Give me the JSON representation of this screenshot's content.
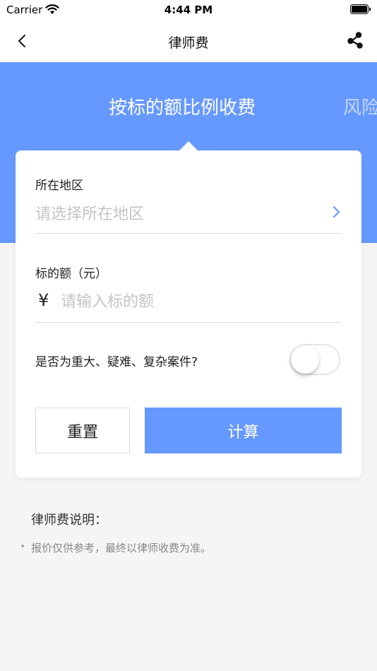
{
  "status_bar": {
    "carrier": "Carrier",
    "time": "4:44 PM"
  },
  "nav": {
    "title": "律师费",
    "back_icon": "chevron-left-icon",
    "share_icon": "share-icon"
  },
  "tabs": [
    {
      "label": "按标的额比例收费",
      "active": true
    },
    {
      "label": "风险",
      "active": false
    }
  ],
  "form": {
    "region": {
      "label": "所在地区",
      "placeholder": "请选择所在地区",
      "value": ""
    },
    "amount": {
      "label": "标的额（元）",
      "currency_symbol": "¥",
      "placeholder": "请输入标的额",
      "value": ""
    },
    "complex_case": {
      "label": "是否为重大、疑难、复杂案件?",
      "on": false
    },
    "reset_label": "重置",
    "calculate_label": "计算"
  },
  "notes": {
    "title": "律师费说明：",
    "items": [
      "报价仅供参考，最终以律师收费为准。"
    ]
  },
  "colors": {
    "accent": "#6699ff",
    "background": "#f5f5f5",
    "placeholder": "#c4c4c4"
  }
}
